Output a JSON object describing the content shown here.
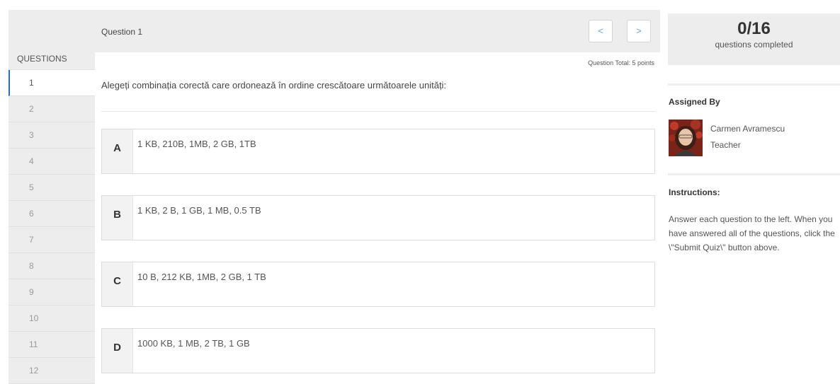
{
  "sidebar": {
    "heading": "QUESTIONS",
    "items": [
      "1",
      "2",
      "3",
      "4",
      "5",
      "6",
      "7",
      "8",
      "9",
      "10",
      "11",
      "12"
    ],
    "active_index": 0
  },
  "question": {
    "title": "Question 1",
    "prev_label": "<",
    "next_label": ">",
    "total": "Question Total: 5 points",
    "text": "Alegeți combinația corectă care ordonează în ordine crescătoare următoarele unități:",
    "options": [
      {
        "letter": "A",
        "text": "1 KB, 210B, 1MB, 2 GB, 1TB"
      },
      {
        "letter": "B",
        "text": "1 KB, 2 B, 1 GB, 1 MB, 0.5 TB"
      },
      {
        "letter": "C",
        "text": "10 B, 212 KB, 1MB, 2 GB, 1 TB"
      },
      {
        "letter": "D",
        "text": "1000 KB, 1 MB, 2 TB, 1 GB"
      }
    ]
  },
  "progress": {
    "count": "0/16",
    "label": "questions completed"
  },
  "assigned": {
    "heading": "Assigned By",
    "name": "Carmen Avramescu",
    "role": "Teacher"
  },
  "instructions": {
    "heading": "Instructions:",
    "text": "Answer each question to the left. When you have answered all of the questions, click the \\\"Submit Quiz\\\" button above."
  },
  "colors": {
    "accent": "#1e73be",
    "panel_bg": "#ededed",
    "nav_arrow": "#6ea3d6"
  }
}
